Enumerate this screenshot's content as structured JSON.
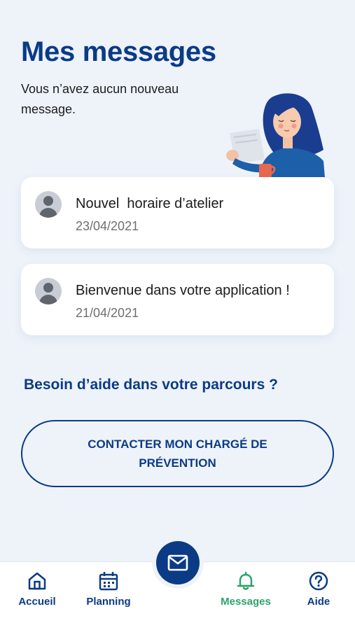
{
  "header": {
    "title": "Mes messages",
    "subtitle": "Vous n’avez aucun nouveau message."
  },
  "messages": [
    {
      "title": "Nouvel  horaire d’atelier",
      "date": "23/04/2021"
    },
    {
      "title": "Bienvenue dans votre application !",
      "date": "21/04/2021"
    }
  ],
  "help": {
    "title": "Besoin d’aide dans votre parcours ?",
    "contact_button": "CONTACTER MON CHARGÉ DE PRÉVENTION"
  },
  "bottom_nav": {
    "items": [
      {
        "label": "Accueil",
        "icon": "home-icon",
        "active": false
      },
      {
        "label": "Planning",
        "icon": "calendar-icon",
        "active": false
      },
      {
        "label": "Messages",
        "icon": "bell-icon",
        "active": true
      },
      {
        "label": "Aide",
        "icon": "help-icon",
        "active": false
      }
    ],
    "center_action_icon": "envelope-icon"
  },
  "colors": {
    "primary": "#0b3b85",
    "active": "#2ea36b",
    "background": "#eef3fa"
  }
}
